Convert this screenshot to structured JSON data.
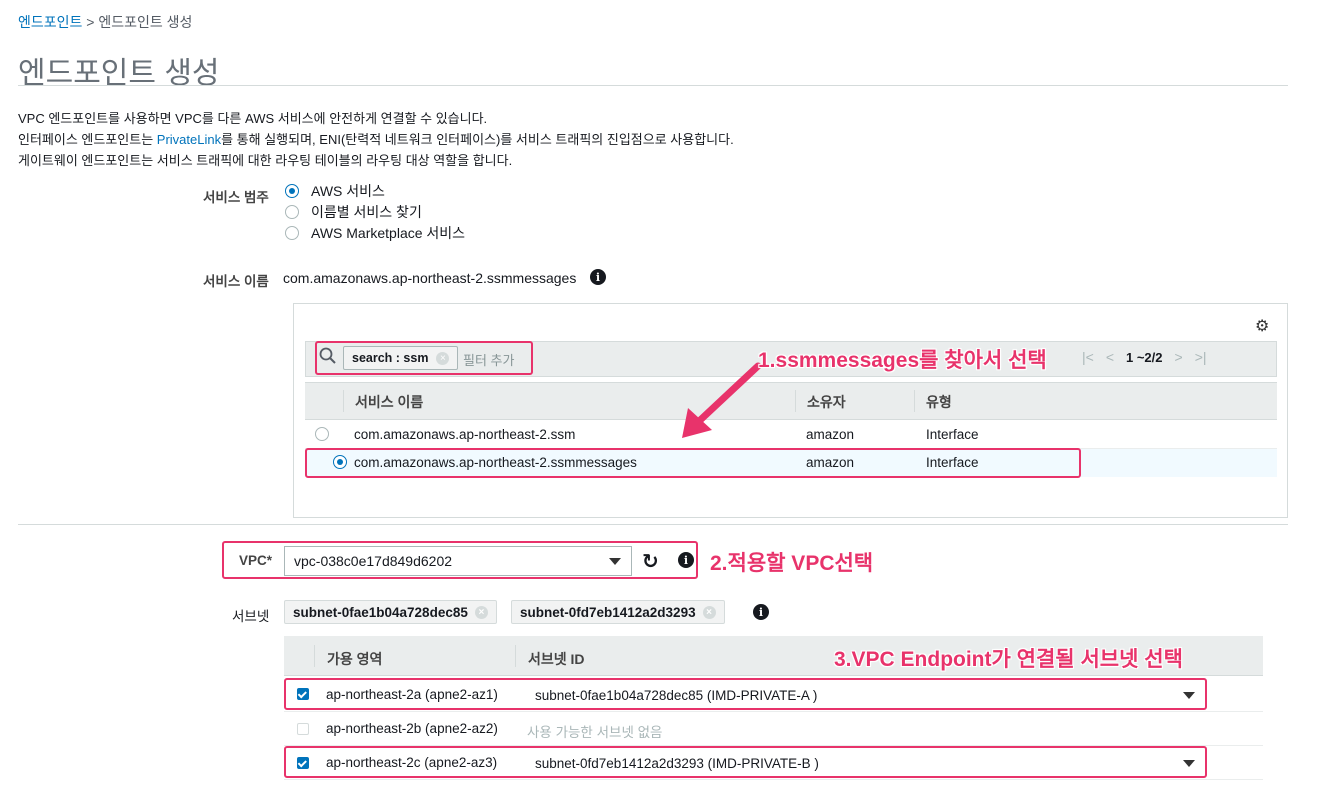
{
  "breadcrumb": {
    "link": "엔드포인트",
    "separator": ">",
    "current": "엔드포인트 생성"
  },
  "page_title": "엔드포인트 생성",
  "description": {
    "line1": "VPC 엔드포인트를 사용하면 VPC를 다른 AWS 서비스에 안전하게 연결할 수 있습니다.",
    "line2_pre": "인터페이스 엔드포인트는 ",
    "line2_link": "PrivateLink",
    "line2_post": "를 통해 실행되며, ENI(탄력적 네트워크 인터페이스)를 서비스 트래픽의 진입점으로 사용합니다.",
    "line3": "게이트웨이 엔드포인트는 서비스 트래픽에 대한 라우팅 테이블의 라우팅 대상 역할을 합니다."
  },
  "service_category": {
    "label": "서비스 범주",
    "options": [
      {
        "label": "AWS 서비스",
        "checked": true
      },
      {
        "label": "이름별 서비스 찾기",
        "checked": false
      },
      {
        "label": "AWS Marketplace 서비스",
        "checked": false
      }
    ]
  },
  "service_name": {
    "label": "서비스 이름",
    "value": "com.amazonaws.ap-northeast-2.ssmmessages"
  },
  "filter": {
    "token": "search : ssm",
    "placeholder": "필터 추가"
  },
  "pager": {
    "first": "|<",
    "prev": "<",
    "count": "1 ~2/2",
    "next": ">",
    "last": ">|"
  },
  "service_table": {
    "columns": [
      "서비스 이름",
      "소유자",
      "유형"
    ],
    "rows": [
      {
        "name": "com.amazonaws.ap-northeast-2.ssm",
        "owner": "amazon",
        "type": "Interface",
        "selected": false
      },
      {
        "name": "com.amazonaws.ap-northeast-2.ssmmessages",
        "owner": "amazon",
        "type": "Interface",
        "selected": true
      }
    ]
  },
  "vpc": {
    "label": "VPC*",
    "value": "vpc-038c0e17d849d6202"
  },
  "subnet": {
    "label": "서브넷",
    "tokens": [
      "subnet-0fae1b04a728dec85",
      "subnet-0fd7eb1412a2d3293"
    ]
  },
  "az_table": {
    "columns": [
      "가용 영역",
      "서브넷 ID"
    ],
    "rows": [
      {
        "az": "ap-northeast-2a (apne2-az1)",
        "subnet": "subnet-0fae1b04a728dec85 (IMD-PRIVATE-A )",
        "checked": true
      },
      {
        "az": "ap-northeast-2b (apne2-az2)",
        "subnet": "사용 가능한 서브넷 없음",
        "checked": false
      },
      {
        "az": "ap-northeast-2c (apne2-az3)",
        "subnet": "subnet-0fd7eb1412a2d3293 (IMD-PRIVATE-B )",
        "checked": true
      }
    ]
  },
  "annotations": {
    "step1": "1.ssmmessages를 찾아서 선택",
    "step2": "2.적용할 VPC선택",
    "step3": "3.VPC Endpoint가 연결될 서브넷 선택"
  },
  "colors": {
    "accent": "#0073bb",
    "annotation": "#e8336b",
    "header_bg": "#eaeded"
  }
}
